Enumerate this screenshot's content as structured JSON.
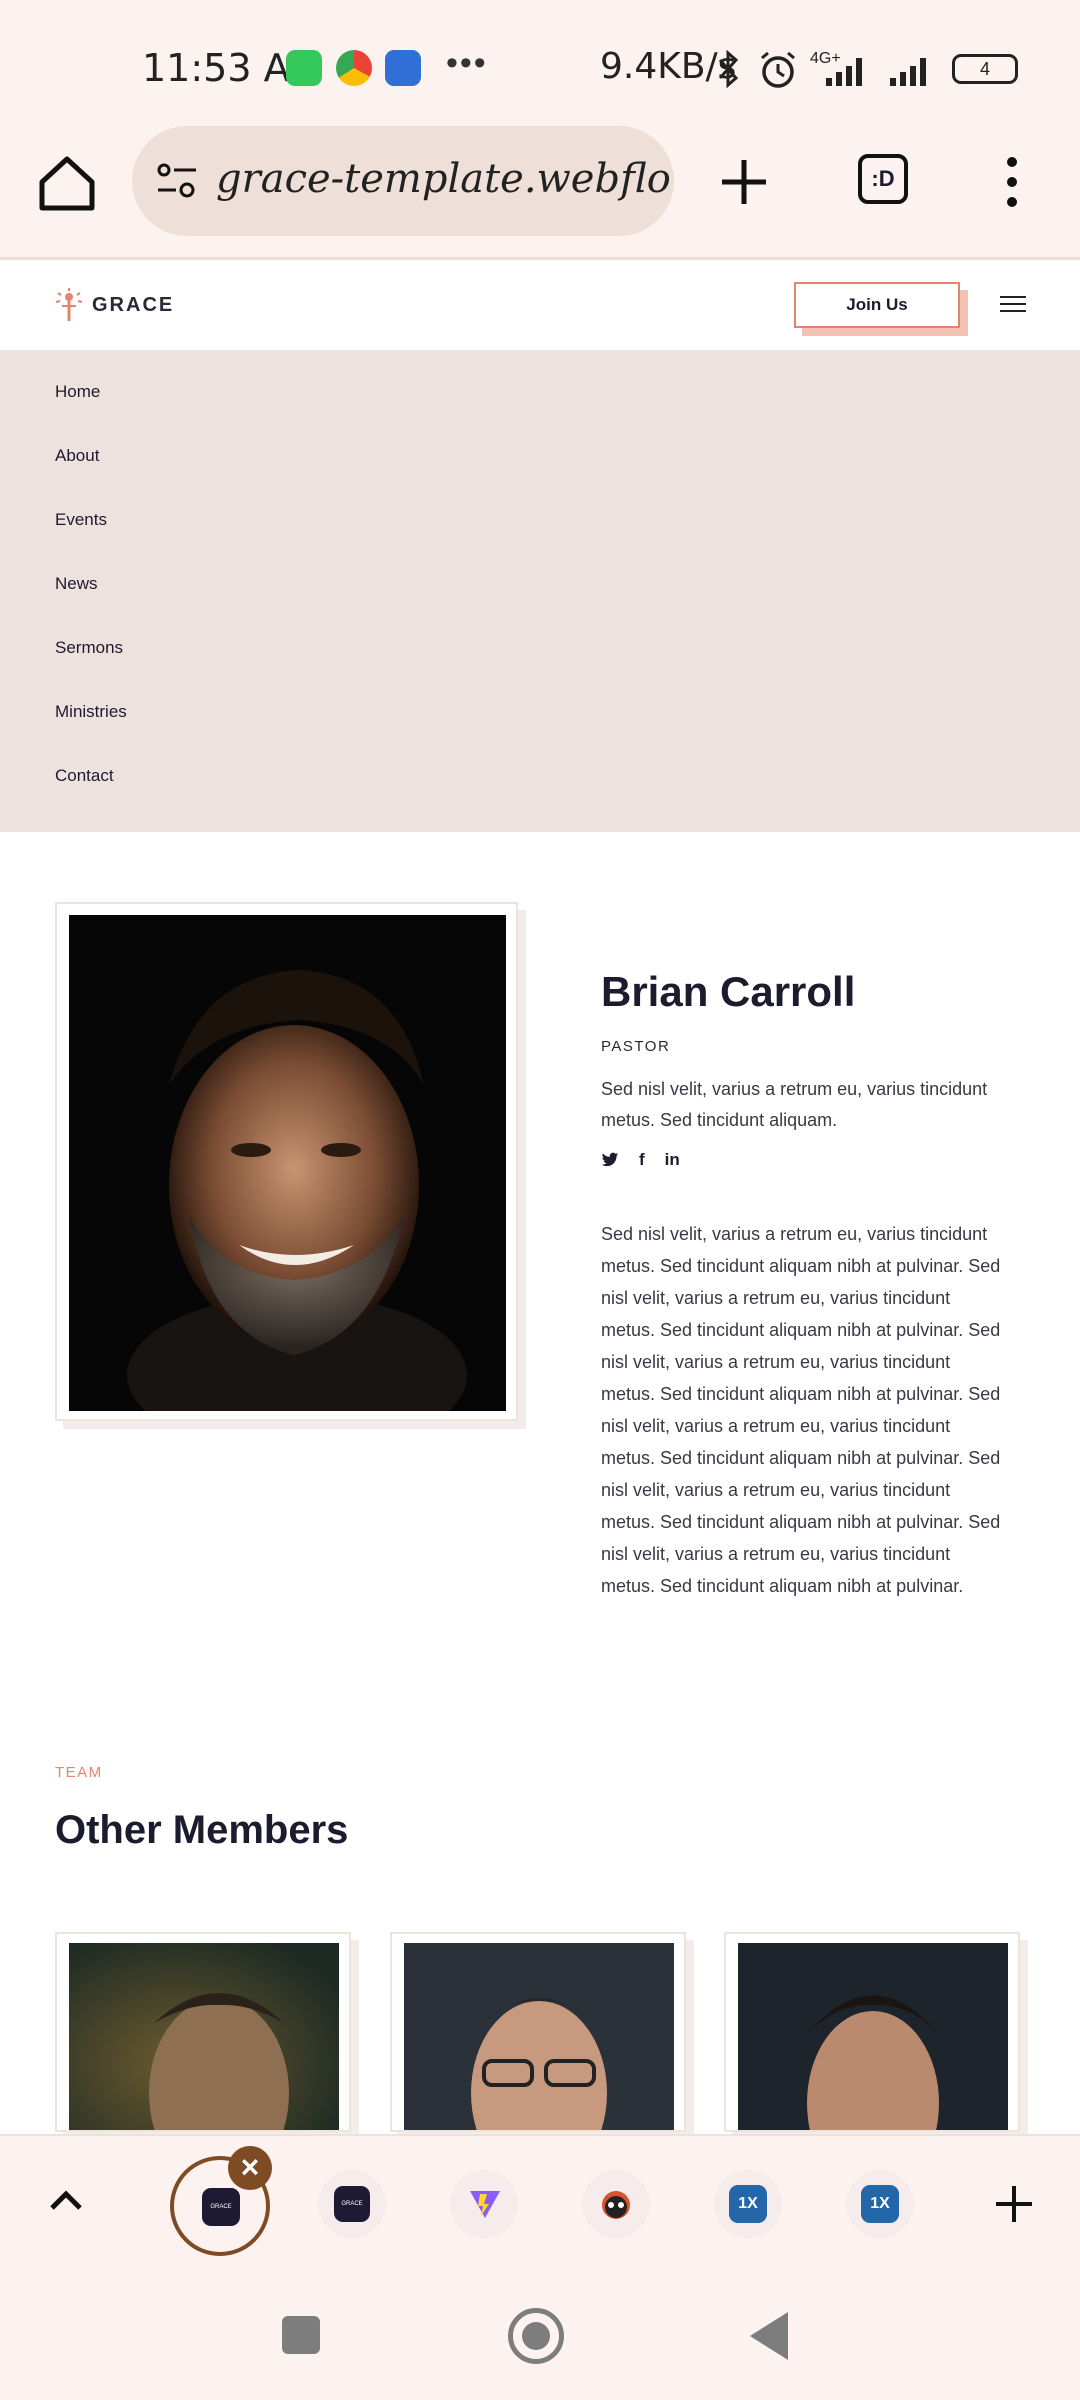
{
  "status_bar": {
    "time": "11:53 AM",
    "network_speed": "9.4KB/s",
    "network_type": "4G+",
    "battery": "4",
    "icons": [
      "whatsapp-icon",
      "chrome-icon",
      "bluetooth-app-icon",
      "more-dots-icon",
      "bluetooth-icon",
      "alarm-icon",
      "signal-icon",
      "battery-icon"
    ]
  },
  "browser": {
    "url": "grace-template.webflow.io",
    "tab_count_label": ":D"
  },
  "site": {
    "logo_text": "GRACE",
    "join_label": "Join Us",
    "brand_color": "#e0856f"
  },
  "nav": {
    "items": [
      "Home",
      "About",
      "Events",
      "News",
      "Sermons",
      "Ministries",
      "Contact"
    ]
  },
  "profile": {
    "name": "Brian Carroll",
    "role": "PASTOR",
    "short_bio": "Sed nisl velit, varius a retrum eu, varius tincidunt metus. Sed tincidunt aliquam.",
    "social": [
      "twitter-icon",
      "facebook-icon",
      "linkedin-icon"
    ],
    "long_bio": "Sed nisl velit, varius a retrum eu, varius tincidunt metus. Sed tincidunt aliquam nibh at pulvinar. Sed nisl velit, varius a retrum eu, varius tincidunt metus. Sed tincidunt aliquam nibh at pulvinar. Sed nisl velit, varius a retrum eu, varius tincidunt metus. Sed tincidunt aliquam nibh at pulvinar. Sed nisl velit, varius a retrum eu, varius tincidunt metus. Sed tincidunt aliquam nibh at pulvinar. Sed nisl velit, varius a retrum eu, varius tincidunt metus. Sed tincidunt aliquam nibh at pulvinar. Sed nisl velit, varius a retrum eu, varius tincidunt metus. Sed tincidunt aliquam nibh at pulvinar."
  },
  "team": {
    "eyebrow": "TEAM",
    "title": "Other Members"
  },
  "tab_strip": {
    "thumb_label": "GRACE"
  }
}
